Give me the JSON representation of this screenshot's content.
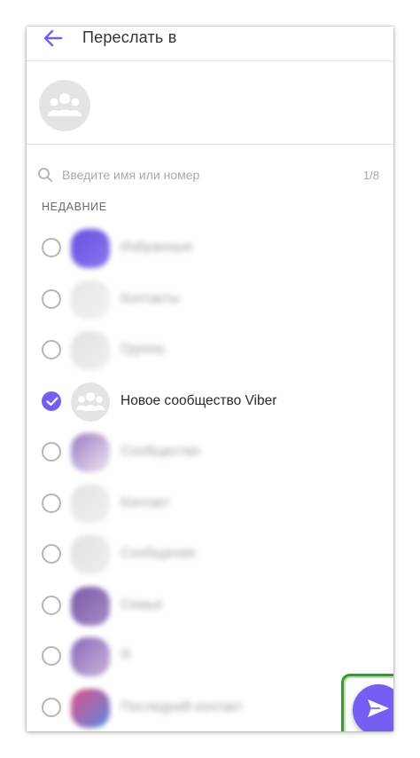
{
  "header": {
    "title": "Переслать в"
  },
  "search": {
    "placeholder": "Введите имя или номер",
    "value": "",
    "counter": "1/8"
  },
  "recent_label": "НЕДАВНИЕ",
  "contacts": [
    {
      "name": "Избранные",
      "selected": false,
      "avatar_colors": [
        "#6a4fe0",
        "#8a76ee"
      ],
      "blurred": true
    },
    {
      "name": "Контакты",
      "selected": false,
      "avatar_colors": [
        "#e6e6e6",
        "#f2f2f2"
      ],
      "blurred": true
    },
    {
      "name": "Группа",
      "selected": false,
      "avatar_colors": [
        "#e2e2e2",
        "#f0f0f0"
      ],
      "blurred": true
    },
    {
      "name": "Новое сообщество Viber",
      "selected": true,
      "avatar_colors": [
        "#e4e4e4",
        "#e4e4e4"
      ],
      "blurred": false
    },
    {
      "name": "Сообщество",
      "selected": false,
      "avatar_colors": [
        "#9a7bc0",
        "#efe6f4"
      ],
      "blurred": true
    },
    {
      "name": "Контакт",
      "selected": false,
      "avatar_colors": [
        "#e3e3e3",
        "#f1f1f1"
      ],
      "blurred": true
    },
    {
      "name": "Сообщения",
      "selected": false,
      "avatar_colors": [
        "#e1e1e1",
        "#efefef"
      ],
      "blurred": true
    },
    {
      "name": "Семья",
      "selected": false,
      "avatar_colors": [
        "#7a5aa8",
        "#a78bc6"
      ],
      "blurred": true
    },
    {
      "name": "Я",
      "selected": false,
      "avatar_colors": [
        "#8a68b8",
        "#c8b4dc"
      ],
      "blurred": true
    },
    {
      "name": "Последний контакт",
      "selected": false,
      "avatar_colors": [
        "#e0508a",
        "#5a8ae0"
      ],
      "blurred": true
    }
  ],
  "colors": {
    "accent": "#7360f2",
    "highlight": "#2f9e2a"
  },
  "icons": {
    "back": "arrow-left-icon",
    "search": "search-icon",
    "send": "send-icon",
    "community": "community-icon"
  }
}
